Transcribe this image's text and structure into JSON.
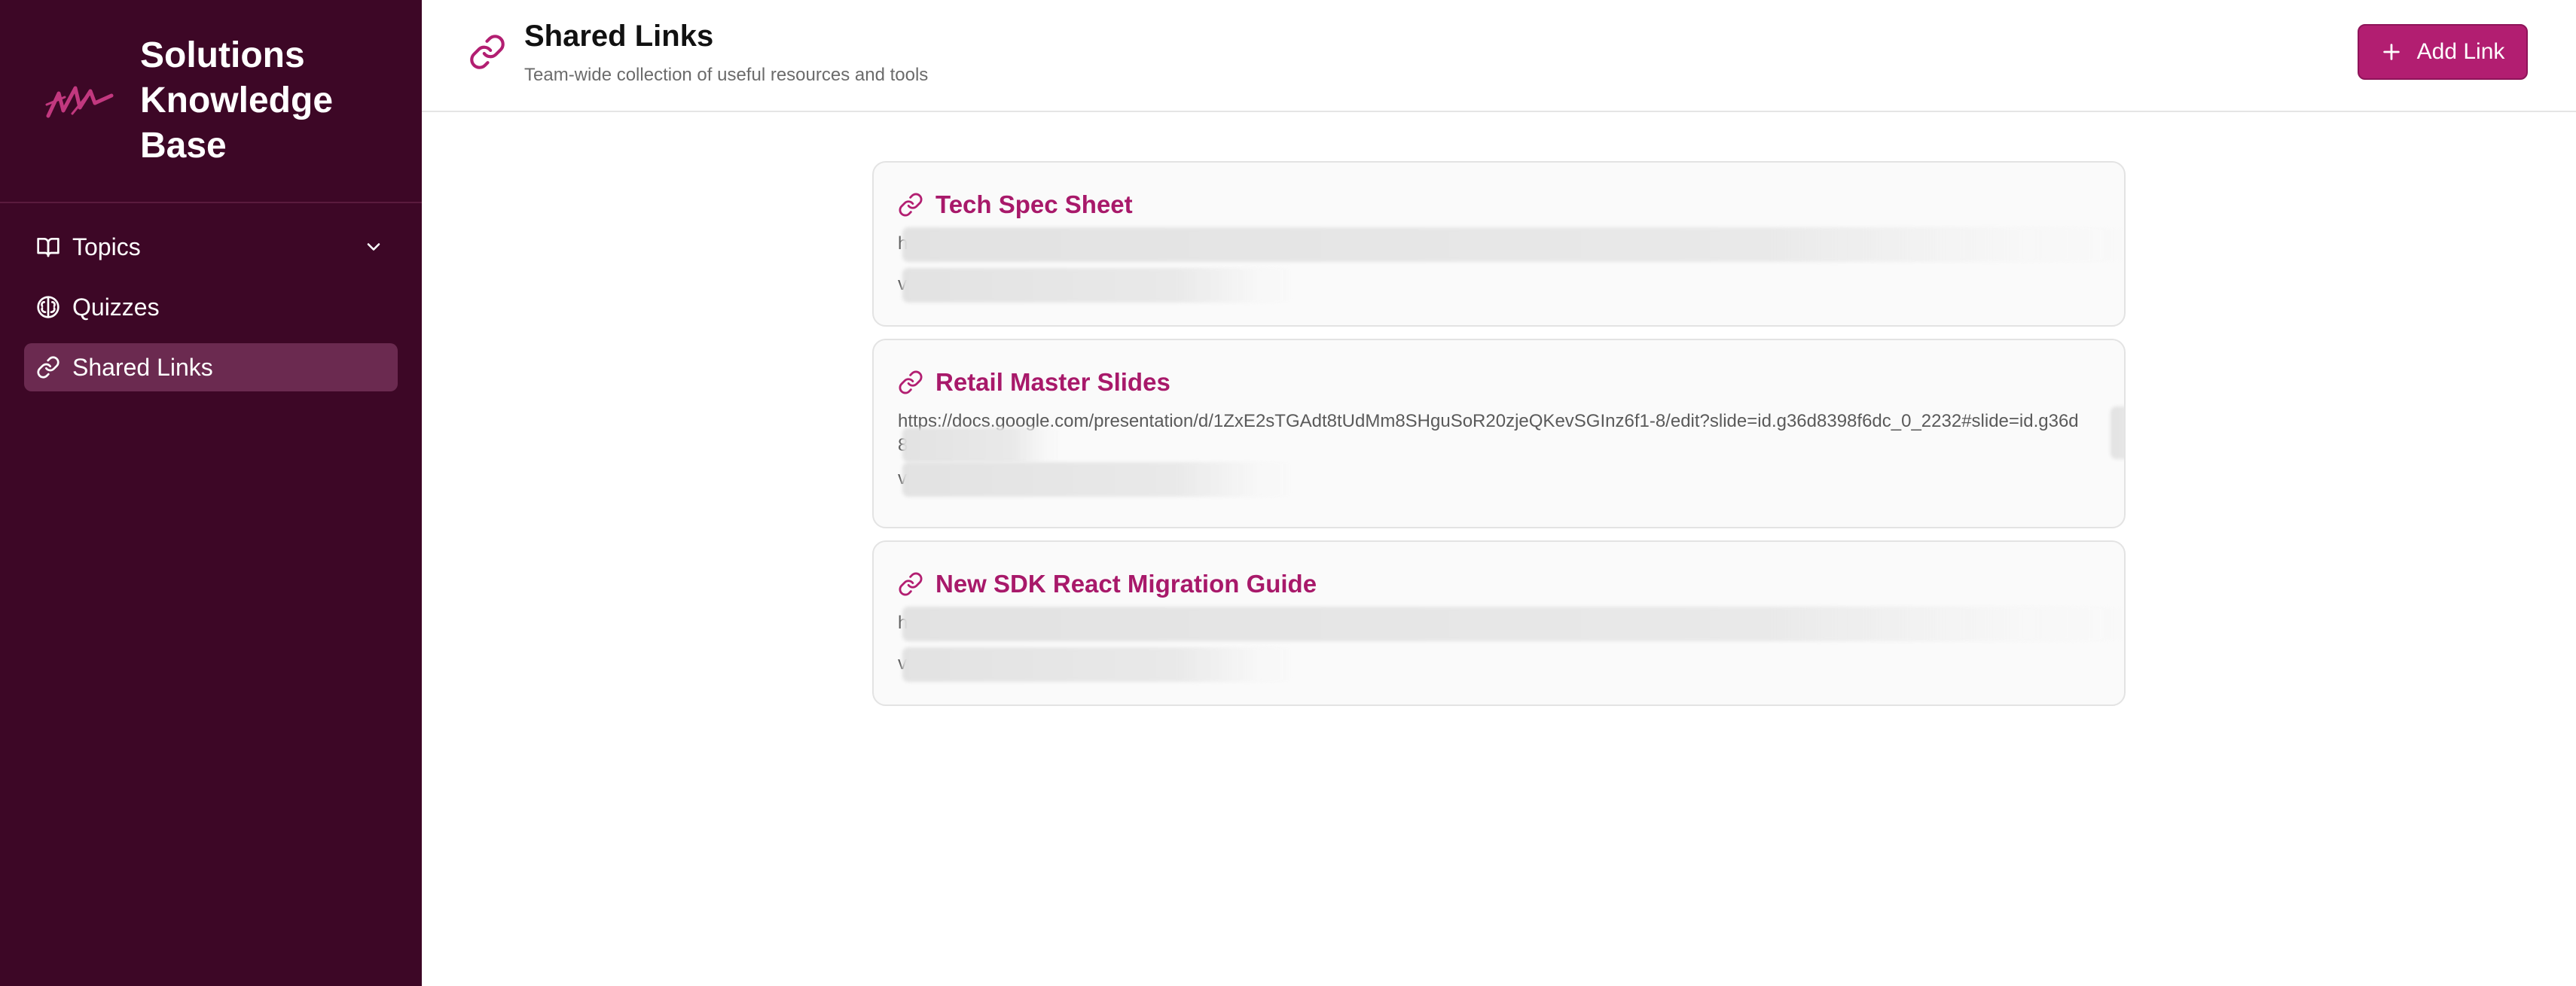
{
  "app": {
    "title": "Solutions Knowledge Base"
  },
  "sidebar": {
    "items": [
      {
        "label": "Topics",
        "icon": "book-open-icon",
        "has_chevron": true
      },
      {
        "label": "Quizzes",
        "icon": "brain-icon"
      },
      {
        "label": "Shared Links",
        "icon": "link-icon",
        "active": true
      }
    ]
  },
  "header": {
    "title": "Shared Links",
    "subtitle": "Team-wide collection of useful resources and tools",
    "add_button_label": "Add Link"
  },
  "cards": [
    {
      "title": "Tech Spec Sheet",
      "url_prefix": "h",
      "meta_prefix": "v"
    },
    {
      "title": "Retail Master Slides",
      "url": "https://docs.google.com/presentation/d/1ZxE2sTGAdt8tUdMm8SHguSoR20zjeQKevSGInz6f1-8/edit?slide=id.g36d8398f6dc_0_2232#slide=id.g36d",
      "url_tail_prefix": "8",
      "meta_prefix": "v"
    },
    {
      "title": "New SDK React Migration Guide",
      "url_prefix": "h",
      "meta_prefix": "v"
    }
  ],
  "colors": {
    "sidebar_bg": "#3d0726",
    "accent": "#b21e71",
    "link_title": "#a8196a"
  }
}
